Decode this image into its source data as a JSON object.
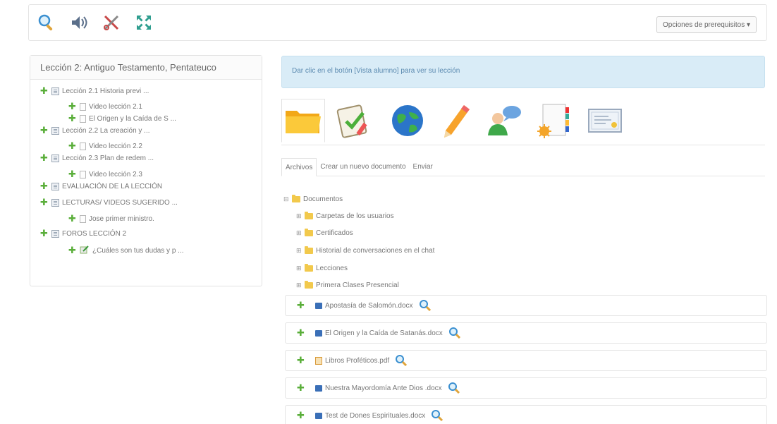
{
  "toolbar": {
    "prereq_label": "Opciones de prerequisitos ▾",
    "icons": [
      "search-icon",
      "audio-icon",
      "tools-icon",
      "fullscreen-icon"
    ]
  },
  "sidebar": {
    "title": "Lección 2: Antiguo Testamento, Pentateuco",
    "items": [
      {
        "label": "Lección 2.1 Historia previ ...",
        "type": "lesson"
      },
      {
        "label": "Video lección 2.1",
        "type": "doc"
      },
      {
        "label": "El Origen y la Caída de S ...",
        "type": "doc"
      },
      {
        "label": "Lección 2.2 La creación y ...",
        "type": "lesson"
      },
      {
        "label": "Video lección 2.2",
        "type": "doc"
      },
      {
        "label": "Lección 2.3 Plan de redem ...",
        "type": "lesson"
      },
      {
        "label": "Video lección 2.3",
        "type": "doc"
      },
      {
        "label": "EVALUACIÓN DE LA LECCIÓN",
        "type": "lesson"
      },
      {
        "label": "LECTURAS/ VIDEOS SUGERIDO ...",
        "type": "lesson"
      },
      {
        "label": "Jose primer ministro.",
        "type": "doc"
      },
      {
        "label": "FOROS LECCIÓN 2",
        "type": "lesson"
      },
      {
        "label": "¿Cuáles son tus dudas y p ...",
        "type": "forum"
      }
    ]
  },
  "main": {
    "banner": "Dar clic en el botón [Vista alumno] para ver su lección",
    "tool_tabs": [
      "documents-folder-icon",
      "assignment-icon",
      "links-globe-icon",
      "notebook-pencil-icon",
      "chat-users-icon",
      "attendance-icon",
      "certificate-icon"
    ],
    "subtabs": [
      "Archivos",
      "Crear un nuevo documento",
      "Enviar"
    ],
    "tree_root": "Documentos",
    "folders": [
      "Carpetas de los usuarios",
      "Certificados",
      "Historial de conversaciones en el chat",
      "Lecciones",
      "Primera Clases Presencial"
    ],
    "files": [
      {
        "name": "Apostasía de Salomón.docx",
        "kind": "word"
      },
      {
        "name": "El Origen y la Caída de Satanás.docx",
        "kind": "word"
      },
      {
        "name": "Libros Proféticos.pdf",
        "kind": "pdf"
      },
      {
        "name": "Nuestra Mayordomía Ante Dios .docx",
        "kind": "word"
      },
      {
        "name": "Test de Dones Espirituales.docx",
        "kind": "word"
      }
    ]
  }
}
